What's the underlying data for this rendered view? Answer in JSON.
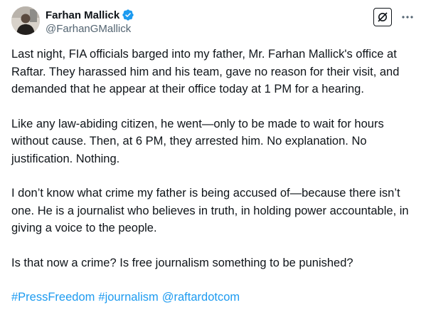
{
  "author": {
    "display_name": "Farhan Mallick",
    "handle": "@FarhanGMallick",
    "verified_icon": "verified-badge-icon",
    "avatar_icon": "profile-photo"
  },
  "actions": {
    "grok_icon": "grok-slash-icon",
    "more_icon": "ellipsis-icon"
  },
  "tweet": {
    "paragraphs": [
      "Last night, FIA officials barged into my father, Mr. Farhan Mallick's office at Raftar. They harassed him and his team, gave no reason for their visit, and demanded that he appear at their office today at 1 PM for a hearing.",
      "Like any law-abiding citizen, he went—only to be made to wait for hours without cause. Then, at 6 PM, they arrested him. No explanation. No justification. Nothing.",
      "I don’t know what crime my father is being accused of—because there isn’t one. He is a journalist who believes in truth, in holding power accountable, in giving a voice to the people.",
      "Is that now a crime? Is free journalism something to be punished?"
    ],
    "hashtags": [
      "#PressFreedom",
      "#journalism",
      "@raftardotcom"
    ]
  },
  "colors": {
    "text": "#0f1419",
    "secondary": "#536471",
    "link": "#1d9bf0",
    "verified": "#1d9bf0"
  }
}
